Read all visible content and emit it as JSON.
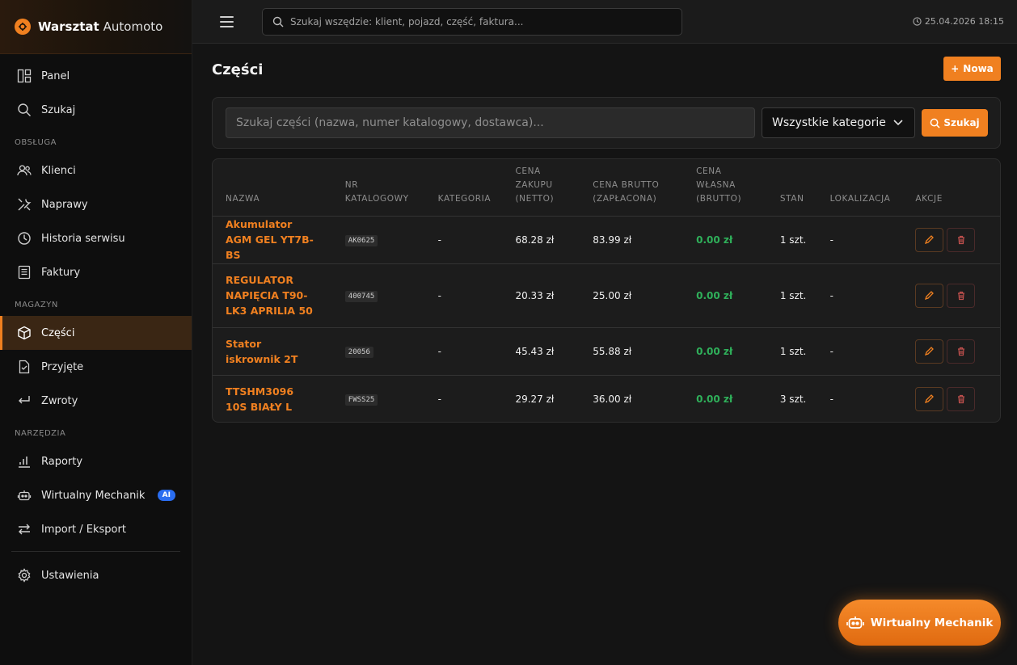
{
  "brand": {
    "name": "Warsztat",
    "sub": "Automoto"
  },
  "sidebar": {
    "items_top": [
      {
        "label": "Panel",
        "icon": "dashboard-icon"
      },
      {
        "label": "Szukaj",
        "icon": "search-icon"
      }
    ],
    "section_service": "OBSŁUGA",
    "items_service": [
      {
        "label": "Klienci",
        "icon": "users-icon"
      },
      {
        "label": "Naprawy",
        "icon": "wrench-icon"
      },
      {
        "label": "Historia serwisu",
        "icon": "clock-icon"
      },
      {
        "label": "Faktury",
        "icon": "invoice-icon"
      }
    ],
    "section_warehouse": "MAGAZYN",
    "items_warehouse": [
      {
        "label": "Części",
        "icon": "box-icon",
        "active": true
      },
      {
        "label": "Przyjęte",
        "icon": "file-check-icon"
      },
      {
        "label": "Zwroty",
        "icon": "return-icon"
      }
    ],
    "section_tools": "NARZĘDZIA",
    "items_tools": [
      {
        "label": "Raporty",
        "icon": "chart-icon"
      },
      {
        "label": "Wirtualny Mechanik",
        "icon": "robot-icon",
        "badge": "AI"
      },
      {
        "label": "Import / Eksport",
        "icon": "arrows-icon"
      }
    ],
    "settings_label": "Ustawienia"
  },
  "topbar": {
    "search_placeholder": "Szukaj wszędzie: klient, pojazd, część, faktura...",
    "datetime": "25.04.2026 18:15"
  },
  "page": {
    "title": "Części",
    "new_label": "Nowa",
    "search_placeholder": "Szukaj części (nazwa, numer katalogowy, dostawca)...",
    "category_selected": "Wszystkie kategorie",
    "search_button": "Szukaj"
  },
  "table": {
    "headers": [
      "NAZWA",
      "NR KATALOGOWY",
      "KATEGORIA",
      "CENA ZAKUPU (NETTO)",
      "CENA BRUTTO (ZAPŁACONA)",
      "CENA WŁASNA (BRUTTO)",
      "STAN",
      "LOKALIZACJA",
      "AKCJE"
    ],
    "rows": [
      {
        "name": "Akumulator AGM GEL YT7B-BS",
        "catalog": "AK0625",
        "category": "-",
        "purchase": "68.28 zł",
        "gross": "83.99 zł",
        "own": "0.00 zł",
        "stock": "1 szt.",
        "location": "-"
      },
      {
        "name": "REGULATOR NAPIĘCIA T90-LK3 APRILIA 50",
        "catalog": "400745",
        "category": "-",
        "purchase": "20.33 zł",
        "gross": "25.00 zł",
        "own": "0.00 zł",
        "stock": "1 szt.",
        "location": "-"
      },
      {
        "name": "Stator iskrownik 2T",
        "catalog": "20056",
        "category": "-",
        "purchase": "45.43 zł",
        "gross": "55.88 zł",
        "own": "0.00 zł",
        "stock": "1 szt.",
        "location": "-"
      },
      {
        "name": "TTSHM3096 10S BIAŁY L",
        "catalog": "FWSS25",
        "category": "-",
        "purchase": "29.27 zł",
        "gross": "36.00 zł",
        "own": "0.00 zł",
        "stock": "3 szt.",
        "location": "-"
      }
    ]
  },
  "fab": {
    "label": "Wirtualny Mechanik"
  },
  "colors": {
    "accent": "#f08020",
    "success": "#2fb05a",
    "badge": "#2a6df0"
  }
}
